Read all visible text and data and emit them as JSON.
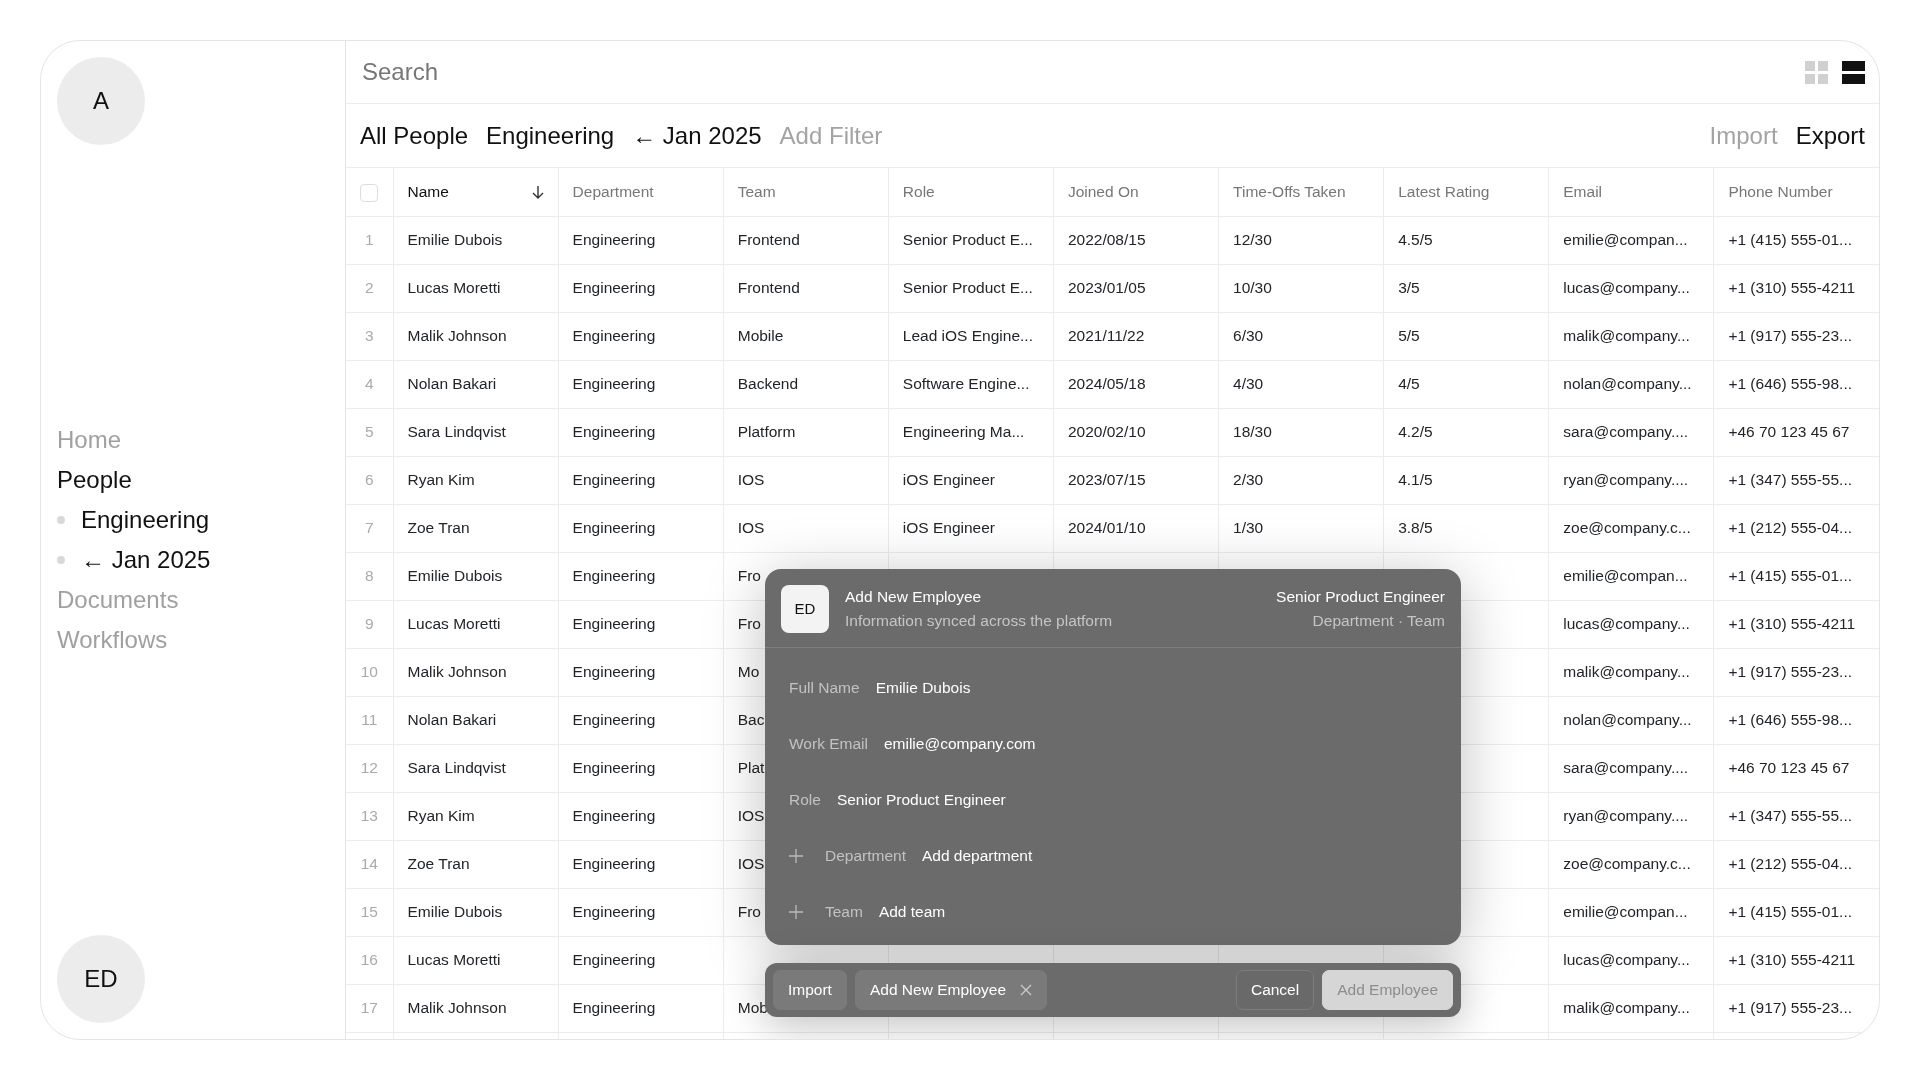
{
  "sidebar": {
    "logo": "A",
    "nav": [
      {
        "label": "Home",
        "selected": false
      },
      {
        "label": "People",
        "selected": true,
        "children": [
          {
            "label": "Engineering",
            "selected": true
          },
          {
            "label": "← Jan 2025",
            "selected": true
          }
        ]
      },
      {
        "label": "Documents",
        "selected": false
      },
      {
        "label": "Workflows",
        "selected": false
      }
    ],
    "user": "ED"
  },
  "search": {
    "placeholder": "Search"
  },
  "views": [
    {
      "kind": "grid",
      "selected": false
    },
    {
      "kind": "list",
      "selected": true
    }
  ],
  "filters": [
    {
      "label": "All People",
      "kind": "filter"
    },
    {
      "label": "Engineering",
      "kind": "filter"
    },
    {
      "label": "← Jan 2025",
      "kind": "filter"
    },
    {
      "label": "Add Filter",
      "kind": "add"
    }
  ],
  "actions": [
    {
      "label": "Import",
      "disabled": true
    },
    {
      "label": "Export",
      "disabled": false
    }
  ],
  "table": {
    "select_all": {
      "checked": false
    },
    "columns": [
      {
        "label": "Name",
        "sorted": true
      },
      {
        "label": "Department",
        "sorted": false
      },
      {
        "label": "Team",
        "sorted": false
      },
      {
        "label": "Role",
        "sorted": false
      },
      {
        "label": "Joined On",
        "sorted": false
      },
      {
        "label": "Time-Offs Taken",
        "sorted": false
      },
      {
        "label": "Latest Rating",
        "sorted": false
      },
      {
        "label": "Email",
        "sorted": false
      },
      {
        "label": "Phone Number",
        "sorted": false
      }
    ],
    "rows": [
      {
        "index": "1",
        "cells": [
          "Emilie Dubois",
          "Engineering",
          "Frontend",
          "Senior Product E...",
          "2022/08/15",
          "12/30",
          "4.5/5",
          "emilie@compan...",
          "+1 (415) 555-01..."
        ]
      },
      {
        "index": "2",
        "cells": [
          "Lucas Moretti",
          "Engineering",
          "Frontend",
          "Senior Product E...",
          "2023/01/05",
          "10/30",
          "3/5",
          "lucas@company...",
          "+1 (310) 555-4211"
        ]
      },
      {
        "index": "3",
        "cells": [
          "Malik Johnson",
          "Engineering",
          "Mobile",
          "Lead iOS Engine...",
          "2021/11/22",
          "6/30",
          "5/5",
          "malik@company...",
          "+1 (917) 555-23..."
        ]
      },
      {
        "index": "4",
        "cells": [
          "Nolan Bakari",
          "Engineering",
          "Backend",
          "Software Engine...",
          "2024/05/18",
          "4/30",
          "4/5",
          "nolan@company...",
          "+1 (646) 555-98..."
        ]
      },
      {
        "index": "5",
        "cells": [
          "Sara Lindqvist",
          "Engineering",
          "Platform",
          "Engineering Ma...",
          "2020/02/10",
          "18/30",
          "4.2/5",
          "sara@company....",
          "+46 70 123 45 67"
        ]
      },
      {
        "index": "6",
        "cells": [
          "Ryan Kim",
          "Engineering",
          "IOS",
          "iOS Engineer",
          "2023/07/15",
          "2/30",
          "4.1/5",
          "ryan@company....",
          "+1 (347) 555-55..."
        ]
      },
      {
        "index": "7",
        "cells": [
          "Zoe Tran",
          "Engineering",
          "IOS",
          "iOS Engineer",
          "2024/01/10",
          "1/30",
          "3.8/5",
          "zoe@company.c...",
          "+1 (212) 555-04..."
        ]
      },
      {
        "index": "8",
        "cells": [
          "Emilie Dubois",
          "Engineering",
          "Fro",
          "",
          "",
          "",
          "",
          "emilie@compan...",
          "+1 (415) 555-01..."
        ]
      },
      {
        "index": "9",
        "cells": [
          "Lucas Moretti",
          "Engineering",
          "Fro",
          "",
          "",
          "",
          "",
          "lucas@company...",
          "+1 (310) 555-4211"
        ]
      },
      {
        "index": "10",
        "cells": [
          "Malik Johnson",
          "Engineering",
          "Mo",
          "",
          "",
          "",
          "",
          "malik@company...",
          "+1 (917) 555-23..."
        ]
      },
      {
        "index": "11",
        "cells": [
          "Nolan Bakari",
          "Engineering",
          "Bac",
          "",
          "",
          "",
          "",
          "nolan@company...",
          "+1 (646) 555-98..."
        ]
      },
      {
        "index": "12",
        "cells": [
          "Sara Lindqvist",
          "Engineering",
          "Plat",
          "",
          "",
          "",
          "",
          "sara@company....",
          "+46 70 123 45 67"
        ]
      },
      {
        "index": "13",
        "cells": [
          "Ryan Kim",
          "Engineering",
          "IOS",
          "",
          "",
          "",
          "",
          "ryan@company....",
          "+1 (347) 555-55..."
        ]
      },
      {
        "index": "14",
        "cells": [
          "Zoe Tran",
          "Engineering",
          "IOS",
          "",
          "",
          "",
          "",
          "zoe@company.c...",
          "+1 (212) 555-04..."
        ]
      },
      {
        "index": "15",
        "cells": [
          "Emilie Dubois",
          "Engineering",
          "Fro",
          "",
          "",
          "",
          "",
          "emilie@compan...",
          "+1 (415) 555-01..."
        ]
      },
      {
        "index": "16",
        "cells": [
          "Lucas Moretti",
          "Engineering",
          "",
          "",
          "",
          "",
          "",
          "lucas@company...",
          "+1 (310) 555-4211"
        ]
      },
      {
        "index": "17",
        "cells": [
          "Malik Johnson",
          "Engineering",
          "Mob",
          "",
          "",
          "",
          "",
          "malik@company...",
          "+1 (917) 555-23..."
        ]
      }
    ]
  },
  "modal": {
    "avatar": "ED",
    "title": "Add New Employee",
    "subtitle": "Information synced across the platform",
    "right_title": "Senior Product Engineer",
    "right_subtitle": "Department · Team",
    "fields": [
      {
        "label": "Full Name",
        "value": "Emilie Dubois",
        "kind": "filled"
      },
      {
        "label": "Work Email",
        "value": "emilie@company.com",
        "kind": "filled"
      },
      {
        "label": "Role",
        "value": "Senior Product Engineer",
        "kind": "filled"
      },
      {
        "label": "Department",
        "value": "Add department",
        "kind": "add"
      },
      {
        "label": "Team",
        "value": "Add team",
        "kind": "add"
      }
    ]
  },
  "action_bar": {
    "left": [
      {
        "label": "Import",
        "kind": "button"
      },
      {
        "label": "Add New Employee",
        "kind": "tab"
      }
    ],
    "right": [
      {
        "label": "Cancel",
        "kind": "outline"
      },
      {
        "label": "Add Employee",
        "kind": "primary"
      }
    ]
  }
}
